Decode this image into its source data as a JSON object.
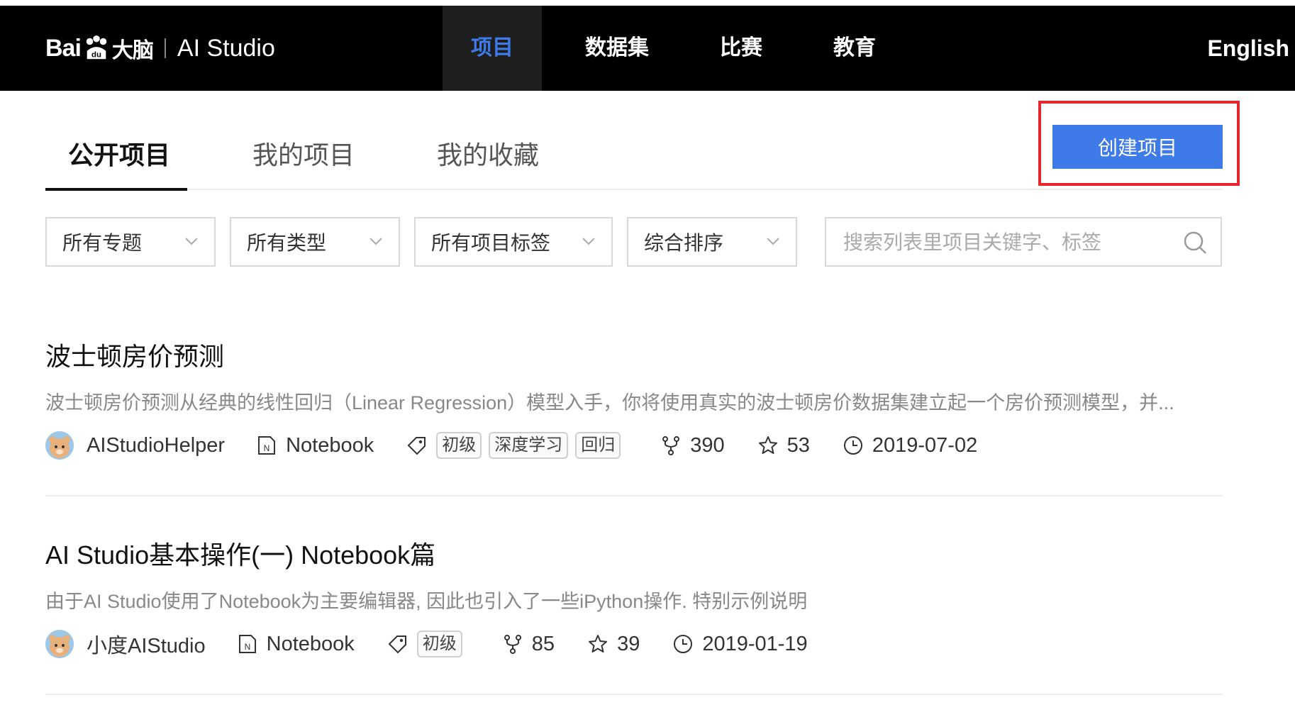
{
  "colors": {
    "accent": "#3e7be9",
    "highlight": "#e5262c",
    "nav_bg": "#000000"
  },
  "header": {
    "logo_baidu": "Bai",
    "logo_paw": "du",
    "logo_brain": "大脑",
    "logo_studio": "AI Studio",
    "nav": [
      {
        "label": "项目",
        "active": true
      },
      {
        "label": "数据集",
        "active": false
      },
      {
        "label": "比赛",
        "active": false
      },
      {
        "label": "教育",
        "active": false
      }
    ],
    "language": "English"
  },
  "tabs": [
    {
      "label": "公开项目",
      "active": true
    },
    {
      "label": "我的项目",
      "active": false
    },
    {
      "label": "我的收藏",
      "active": false
    }
  ],
  "create_button": "创建项目",
  "filters": [
    {
      "value": "所有专题"
    },
    {
      "value": "所有类型"
    },
    {
      "value": "所有项目标签"
    },
    {
      "value": "综合排序"
    }
  ],
  "search": {
    "placeholder": "搜索列表里项目关键字、标签",
    "value": "",
    "icon": "search-icon"
  },
  "projects": [
    {
      "title": "波士顿房价预测",
      "description": "波士顿房价预测从经典的线性回归（Linear Regression）模型入手，你将使用真实的波士顿房价数据集建立起一个房价预测模型，并...",
      "author": "AIStudioHelper",
      "type": "Notebook",
      "tags": [
        "初级",
        "深度学习",
        "回归"
      ],
      "forks": "390",
      "stars": "53",
      "date": "2019-07-02"
    },
    {
      "title": "AI Studio基本操作(一) Notebook篇",
      "description": "由于AI Studio使用了Notebook为主要编辑器, 因此也引入了一些iPython操作. 特别示例说明",
      "author": "小度AIStudio",
      "type": "Notebook",
      "tags": [
        "初级"
      ],
      "forks": "85",
      "stars": "39",
      "date": "2019-01-19"
    }
  ]
}
